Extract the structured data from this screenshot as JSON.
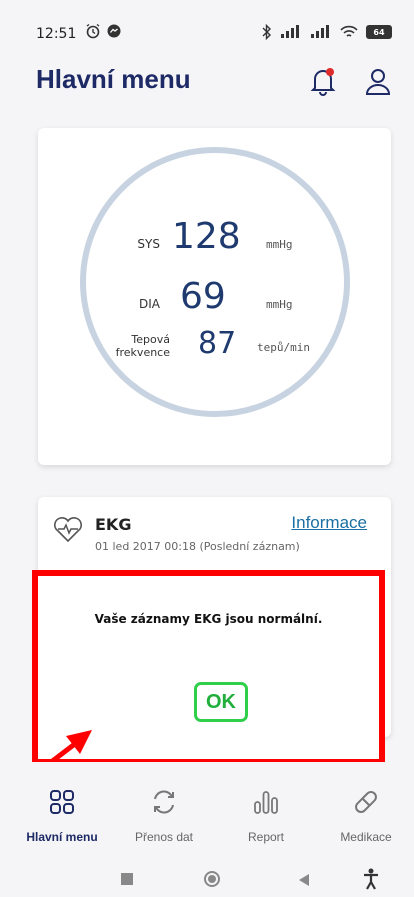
{
  "status": {
    "time": "12:51",
    "battery": "64"
  },
  "header": {
    "title": "Hlavní menu"
  },
  "blood_pressure": {
    "sys_label": "SYS",
    "sys_value": "128",
    "sys_unit": "mmHg",
    "dia_label": "DIA",
    "dia_value": "69",
    "dia_unit": "mmHg",
    "pulse_label_1": "Tepová",
    "pulse_label_2": "frekvence",
    "pulse_value": "87",
    "pulse_unit": "tepů/min"
  },
  "ekg": {
    "title": "EKG",
    "info_link": "Informace",
    "date": "01 led 2017 00:18 (Poslední záznam)"
  },
  "dialog": {
    "message": "Vaše záznamy EKG jsou normální.",
    "ok_label": "OK"
  },
  "nav": {
    "items": [
      {
        "label": "Hlavní menu",
        "icon": "grid-icon"
      },
      {
        "label": "Přenos dat",
        "icon": "sync-icon"
      },
      {
        "label": "Report",
        "icon": "chart-icon"
      },
      {
        "label": "Medikace",
        "icon": "pill-icon"
      }
    ]
  },
  "colors": {
    "primary": "#1e2a66",
    "highlight": "#ff0000",
    "ok_green": "#2fcf4a",
    "ring": "#c8d3e2"
  }
}
